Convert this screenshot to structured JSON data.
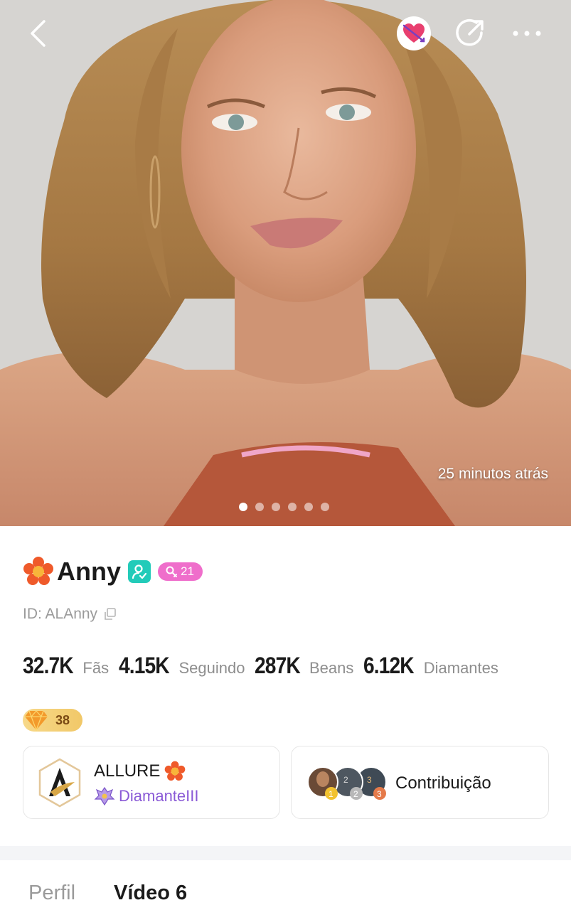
{
  "hero": {
    "timestamp": "25 minutos atrás",
    "photo_count": 6,
    "active_photo_index": 0
  },
  "icons": {
    "back": "chevron-left-icon",
    "heart": "heart-arrow-icon",
    "share": "share-icon",
    "more": "more-dots-icon",
    "copy": "copy-icon"
  },
  "profile": {
    "name": "Anny",
    "level": "21",
    "id_text": "ID: ALAnny"
  },
  "stats": [
    {
      "value": "32.7K",
      "label": "Fãs"
    },
    {
      "value": "4.15K",
      "label": "Seguindo"
    },
    {
      "value": "287K",
      "label": "Beans"
    },
    {
      "value": "6.12K",
      "label": "Diamantes"
    }
  ],
  "diamond_level": "38",
  "family": {
    "name": "ALLURE",
    "rank": "DiamanteIII"
  },
  "contribution": {
    "label": "Contribuição",
    "ranks": [
      "1",
      "2",
      "3"
    ]
  },
  "tabs": [
    {
      "label": "Perfil"
    },
    {
      "label": "Vídeo 6"
    }
  ],
  "colors": {
    "accent_teal": "#22cbb9",
    "level_pink": "#ef6ecb",
    "rank_purple": "#8a5ad6",
    "gold": "#f1c868"
  }
}
